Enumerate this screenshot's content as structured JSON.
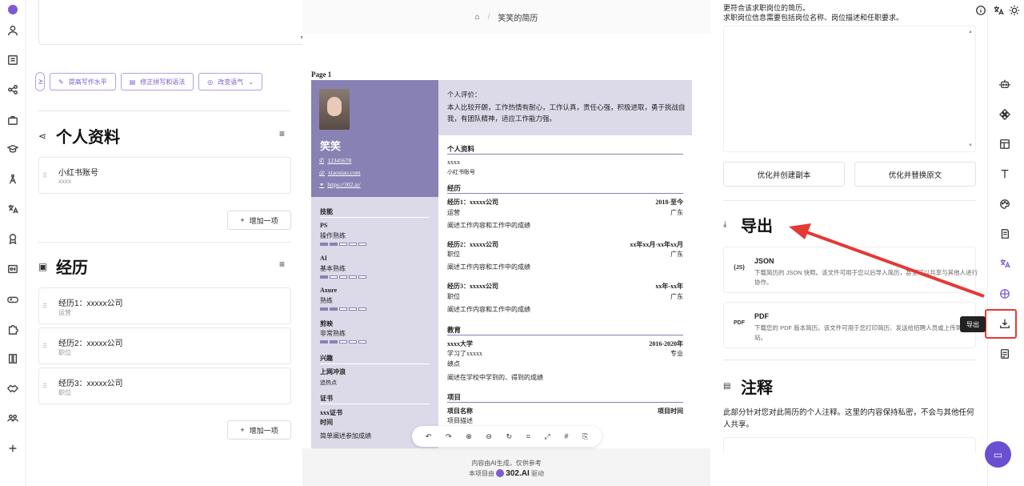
{
  "colors": {
    "accent": "#7c5bd0",
    "resume_dark": "#8782b3",
    "resume_light": "#dcd9e8",
    "highlight": "#e53935"
  },
  "left_rail_icons": [
    "logo-icon",
    "user-icon",
    "document-icon",
    "share-icon",
    "briefcase-icon",
    "graduation-icon",
    "skill-icon",
    "translate-icon",
    "award-icon",
    "id-card-icon",
    "gamepad-icon",
    "puzzle-icon",
    "book-icon",
    "handshake-icon",
    "users-icon",
    "plus-icon"
  ],
  "ai_bar": {
    "tag": "AI",
    "buttons": [
      "提高写作水平",
      "修正拼写和语法",
      "改变语气"
    ]
  },
  "profiles": {
    "title": "个人资料",
    "items": [
      {
        "title": "小红书账号",
        "sub": "xxxx"
      }
    ],
    "add_label": "增加一项"
  },
  "experience": {
    "title": "经历",
    "items": [
      {
        "title": "经历1：xxxxx公司",
        "sub": "运营"
      },
      {
        "title": "经历2：xxxxx公司",
        "sub": "职位"
      },
      {
        "title": "经历3：xxxxx公司",
        "sub": "职位"
      }
    ],
    "add_label": "增加一项"
  },
  "breadcrumb": {
    "title": "笑笑的简历"
  },
  "page_label": "Page 1",
  "resume": {
    "name": "笑笑",
    "contacts": [
      "12345678",
      "xiaoxiao.com",
      "https://302.ai/"
    ],
    "skills_title": "技能",
    "skills": [
      {
        "name": "PS",
        "level_text": "操作熟练",
        "level": 2
      },
      {
        "name": "AI",
        "level_text": "基本熟练",
        "level": 1
      },
      {
        "name": "Axure",
        "level_text": "熟练",
        "level": 2
      },
      {
        "name": "剪映",
        "level_text": "非常熟练",
        "level": 2
      }
    ],
    "interests_title": "兴趣",
    "interest": {
      "name": "上网冲浪",
      "sub": "追热点"
    },
    "cert_title": "证书",
    "cert": {
      "name": "xxx证书",
      "time": "时间",
      "desc": "简单阐述参加成绩"
    },
    "eval_label": "个人评价：",
    "eval_text": "本人比较开朗，工作热情有耐心，工作认真，责任心强，积极进取，勇于挑战自我，有团队精神，适应工作能力强。",
    "profile_title": "个人资料",
    "profile_value": "xxxx",
    "profile_sub": "小红书账号",
    "exp_title": "经历",
    "exps": [
      {
        "company": "经历1：xxxxx公司",
        "date": "2018-至今",
        "role": "运营",
        "loc": "广东",
        "desc": "阐述工作内容和工作中的成绩"
      },
      {
        "company": "经历2：xxxxx公司",
        "date": "xx年xx月-xx年xx月",
        "role": "职位",
        "loc": "广东",
        "desc": "阐述工作内容和工作中的成绩"
      },
      {
        "company": "经历3：xxxxx公司",
        "date": "xx年-xx年",
        "role": "职位",
        "loc": "广东",
        "desc": "阐述工作内容和工作中的成绩"
      }
    ],
    "edu_title": "教育",
    "edu": {
      "school": "xxxx大学",
      "date": "2016-2020年",
      "major": "学习了xxxxx",
      "degree": "专业",
      "gpa": "绩点",
      "desc": "阐述在学校中学到的、得到的成绩"
    },
    "proj_title": "项目",
    "proj": {
      "name": "项目名称",
      "time": "项目时间",
      "desc": "项目描述"
    }
  },
  "toolbar_icons": [
    "undo-icon",
    "redo-icon",
    "zoom-in-icon",
    "zoom-out-icon",
    "reset-zoom-icon",
    "center-icon",
    "fullscreen-icon",
    "grid-icon",
    "page-break-icon"
  ],
  "footer": {
    "line1": "内容由AI生成，仅供参考",
    "line2_prefix": "本项目由",
    "brand": "302.AI",
    "line2_suffix": "驱动"
  },
  "right_panel": {
    "top_text1": "更符合该求职岗位的简历。",
    "top_text2": "求职岗位信息需要包括岗位名称、岗位描述和任职要求。",
    "btn_copy": "优化并创建副本",
    "btn_replace": "优化并替换原文",
    "export_title": "导出",
    "json": {
      "title": "JSON",
      "desc": "下载简历的 JSON 快照。该文件可用于您以后导入简历，甚至可以共享与其他人进行协作。"
    },
    "pdf": {
      "title": "PDF",
      "desc": "下载您的 PDF 版本简历。该文件可用于您打印简历、发送给招聘人员或上传到招聘网站。"
    },
    "notes_title": "注释",
    "notes_text": "此部分针对您对此简历的个人注释。这里的内容保持私密，不会与其他任何人共享。"
  },
  "tooltip": "导出",
  "right_rail_icons": [
    "info-icon",
    "translate-icon",
    "theme-icon",
    "robot-icon",
    "template-icon",
    "layout-icon",
    "typography-icon",
    "palette-icon",
    "page-icon",
    "language-icon",
    "sharing-icon",
    "export-icon",
    "notes-icon",
    "chat-icon"
  ]
}
